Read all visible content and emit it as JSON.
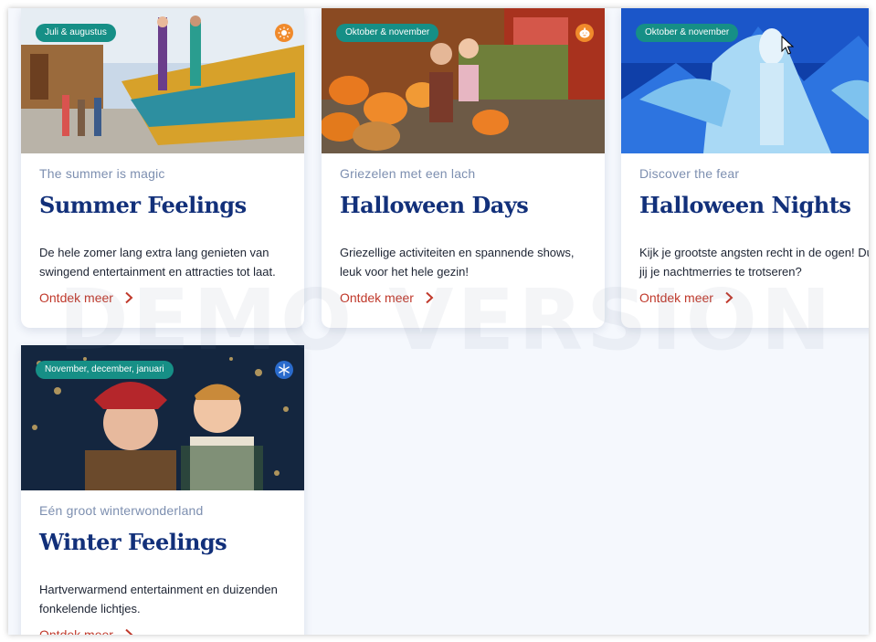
{
  "cards": [
    {
      "badge": "Juli & augustus",
      "season_icon": "sun-icon",
      "subtitle": "The summer is magic",
      "title": "Summer Feelings",
      "description_lines": [
        "De hele zomer lang extra lang genieten van",
        "swingend entertainment en attracties tot laat."
      ],
      "link": "Ontdek meer"
    },
    {
      "badge": "Oktober & november",
      "season_icon": "pumpkin-icon",
      "subtitle": "Griezelen met een lach",
      "title": "Halloween Days",
      "description_lines": [
        "Griezellige activiteiten en spannende shows,",
        "leuk voor het hele gezin!"
      ],
      "link": "Ontdek meer"
    },
    {
      "badge": "Oktober & november",
      "season_icon": "",
      "subtitle": "Discover the fear",
      "title": "Halloween Nights",
      "description_lines": [
        "Kijk je grootste angsten recht in de ogen! Du",
        "jij je nachtmerries te trotseren?"
      ],
      "link": "Ontdek meer"
    },
    {
      "badge": "November, december, januari",
      "season_icon": "snowflake-icon",
      "subtitle": "Eén groot winterwonderland",
      "title": "Winter Feelings",
      "description_lines": [
        "Hartverwarmend entertainment en duizenden",
        "fonkelende lichtjes."
      ],
      "link": "Ontdek meer"
    }
  ],
  "watermark": "DEMO VERSION",
  "colors": {
    "badge": "#168f86",
    "title": "#12307a",
    "subtitle": "#7d8fb0",
    "link": "#c0392b",
    "background": "#f5f8fd"
  }
}
